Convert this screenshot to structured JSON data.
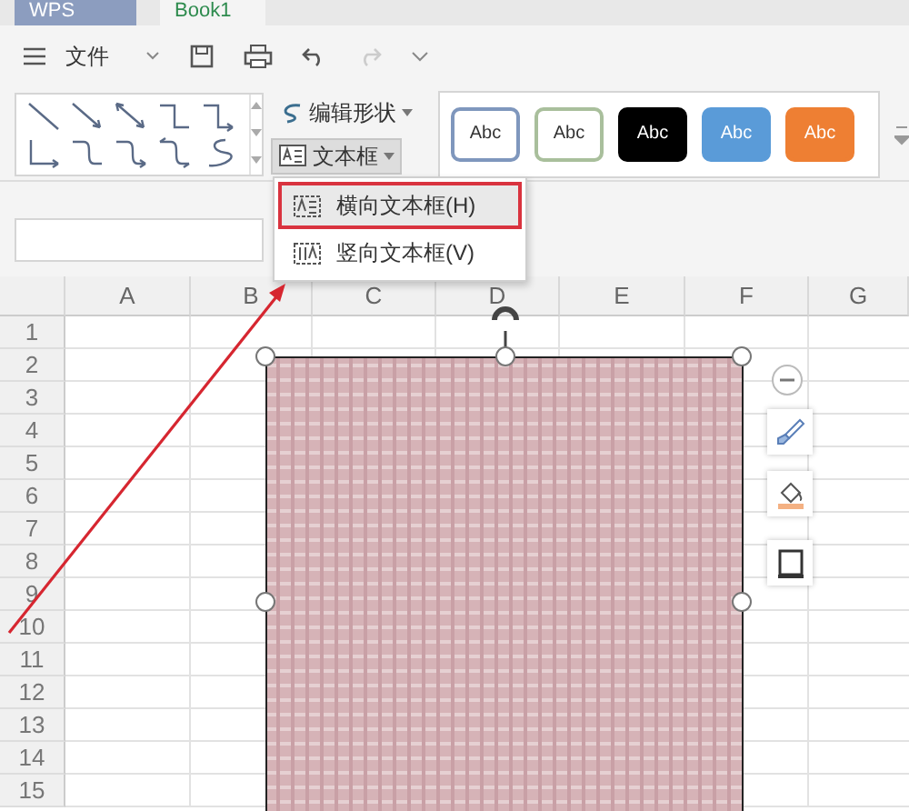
{
  "tabs": [
    {
      "label": "WPS",
      "selected": false
    },
    {
      "label": "Book1",
      "selected": true
    }
  ],
  "toolbar": {
    "file_menu": "文件"
  },
  "ribbon": {
    "edit_shape": "编辑形状",
    "text_box": {
      "label": "文本框",
      "pressed": true
    },
    "styles": [
      {
        "label": "Abc",
        "color": "#7f97bd",
        "filled": false
      },
      {
        "label": "Abc",
        "color": "#a9bf9c",
        "filled": false
      },
      {
        "label": "Abc",
        "color": "#000000",
        "filled": true
      },
      {
        "label": "Abc",
        "color": "#5a9bd8",
        "filled": true
      },
      {
        "label": "Abc",
        "color": "#ee7f33",
        "filled": true
      }
    ]
  },
  "menu": {
    "items": [
      {
        "label": "横向文本框(H)",
        "selected": true
      },
      {
        "label": "竖向文本框(V)",
        "selected": false
      }
    ]
  },
  "sheet": {
    "columns": [
      "A",
      "B",
      "C",
      "D",
      "E",
      "F",
      "G"
    ],
    "rows": [
      "1",
      "2",
      "3",
      "4",
      "5",
      "6",
      "7",
      "8",
      "9",
      "10",
      "11",
      "12",
      "13",
      "14",
      "15"
    ]
  },
  "shape": {
    "selected": true
  }
}
